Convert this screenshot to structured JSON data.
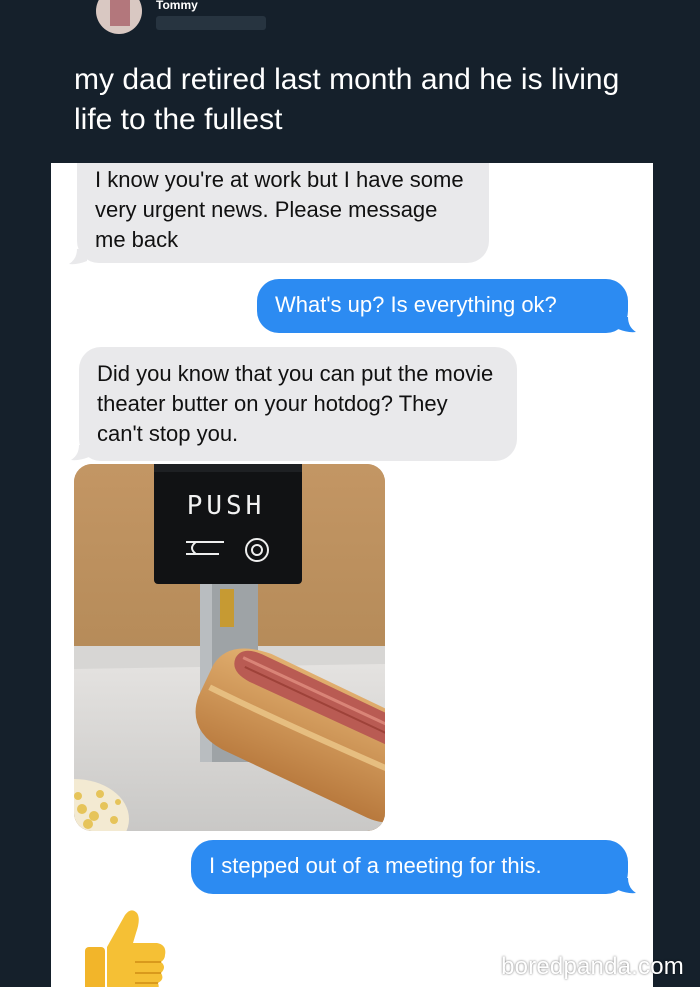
{
  "tweet": {
    "author": "Tommy",
    "text": "my dad retired last month and he is living life to the fullest"
  },
  "conversation": {
    "messages": [
      {
        "sender": "incoming",
        "text": "I know you're at work but I have some very urgent news. Please message me back"
      },
      {
        "sender": "outgoing",
        "text": "What's up? Is everything ok?"
      },
      {
        "sender": "incoming",
        "text": "Did you know that you can put the movie theater butter on your hotdog? They can't stop you."
      },
      {
        "sender": "incoming",
        "type": "photo",
        "sign_text": "PUSH"
      },
      {
        "sender": "outgoing",
        "text": "I stepped out of a meeting for this."
      },
      {
        "sender": "incoming",
        "type": "emoji",
        "icon": "thumbs-up-icon"
      }
    ]
  },
  "watermark": "boredpanda.com",
  "colors": {
    "background": "#15202b",
    "incoming_bubble": "#e9e9eb",
    "outgoing_bubble": "#2c8bf2"
  }
}
